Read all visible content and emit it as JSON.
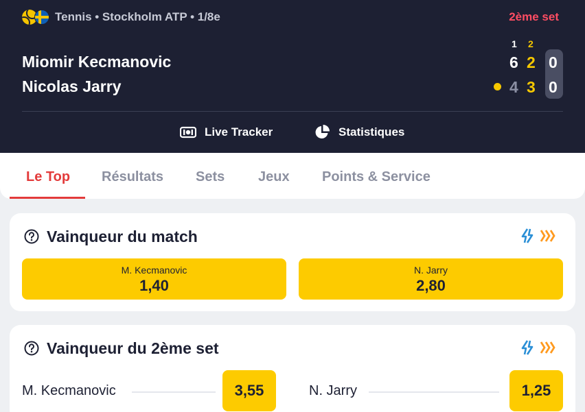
{
  "header": {
    "sport": "Tennis",
    "separator": "•",
    "competition": "Stockholm ATP",
    "round": "1/8e",
    "competition_line": "Tennis • Stockholm ATP • 1/8e",
    "set_status": "2ème set",
    "set_numbers": [
      "1",
      "2"
    ],
    "players": [
      {
        "name": "Miomir Kecmanovic",
        "set1": "6",
        "set2": "2",
        "games": "0",
        "serving": false
      },
      {
        "name": "Nicolas Jarry",
        "set1": "4",
        "set2": "3",
        "games": "0",
        "serving": true
      }
    ],
    "live_tracker_label": "Live Tracker",
    "statistics_label": "Statistiques"
  },
  "tabs": [
    "Le Top",
    "Résultats",
    "Sets",
    "Jeux",
    "Points & Service"
  ],
  "active_tab": "Le Top",
  "markets": [
    {
      "title": "Vainqueur du match",
      "outcomes": [
        {
          "name": "M. Kecmanovic",
          "odd": "1,40"
        },
        {
          "name": "N. Jarry",
          "odd": "2,80"
        }
      ]
    },
    {
      "title": "Vainqueur du 2ème set",
      "outcomes": [
        {
          "name": "M. Kecmanovic",
          "odd": "3,55"
        },
        {
          "name": "N. Jarry",
          "odd": "1,25"
        }
      ]
    }
  ],
  "colors": {
    "header_bg": "#1d2033",
    "accent_red": "#e33b3b",
    "odds_yellow": "#fdcb00",
    "score_yellow": "#f6c800",
    "live_status_red": "#ff4d63",
    "icon_blue": "#2a8fd6",
    "icon_orange": "#ff9a1f"
  },
  "icons": {
    "sport": "tennis-ball-icon",
    "country": "sweden-flag-icon",
    "live_tracker": "live-tracker-icon",
    "statistics": "pie-chart-icon",
    "help": "question-mark-icon",
    "cashout": "cashout-icon",
    "boost": "boost-chevrons-icon"
  }
}
